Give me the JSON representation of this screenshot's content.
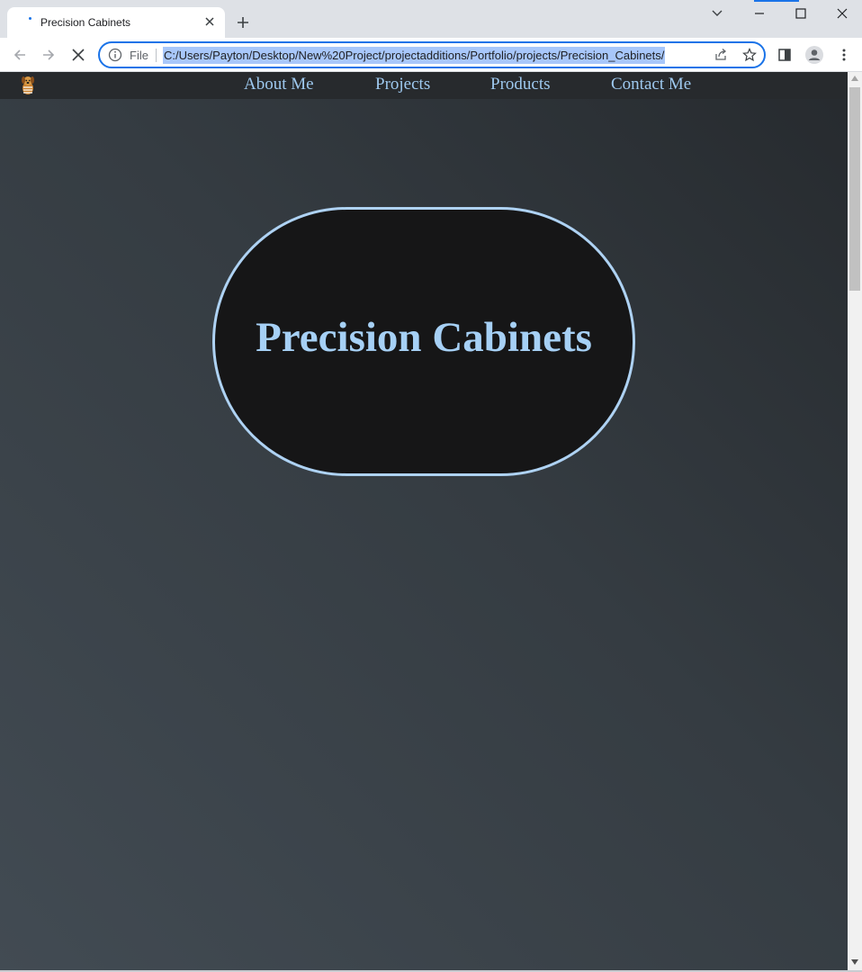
{
  "browser": {
    "tab_title": "Precision Cabinets",
    "address_scheme_label": "File",
    "url": "C:/Users/Payton/Desktop/New%20Project/projectadditions/Portfolio/projects/Precision_Cabinets/",
    "accent_color": "#1a73e8",
    "selection_color": "#a8c7fa"
  },
  "site": {
    "nav": [
      "About Me",
      "Projects",
      "Products",
      "Contact Me"
    ],
    "hero_title": "Precision Cabinets",
    "accent_color": "#a6d0f5",
    "hero_background": "#161617"
  },
  "icons": {
    "tab_favicon": "loading-dot-icon",
    "logo": "dog-logo-icon"
  }
}
